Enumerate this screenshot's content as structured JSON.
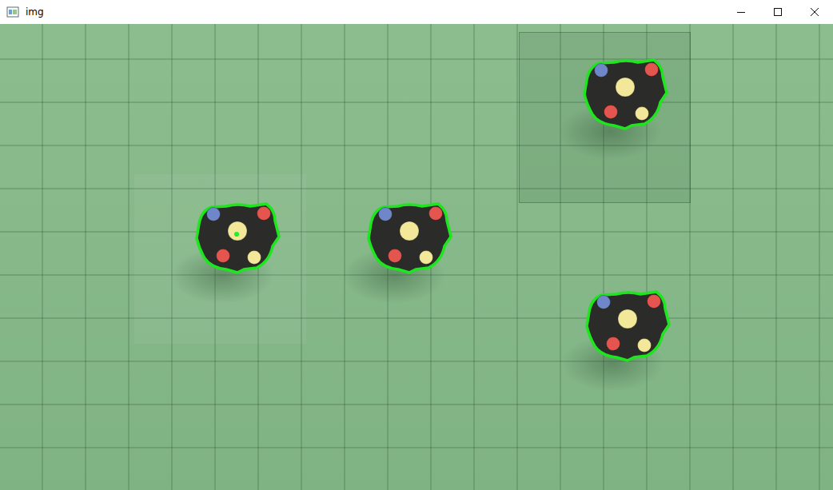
{
  "window": {
    "title": "img"
  },
  "roi": {
    "shown": true
  },
  "robots": [
    {
      "contour": true,
      "center_marker": true,
      "dots": [
        {
          "color": "#6f86c8",
          "big": false
        },
        {
          "color": "#e5554f",
          "big": false
        },
        {
          "color": "#f3e79a",
          "big": true
        },
        {
          "color": "#e5554f",
          "big": false
        },
        {
          "color": "#f3e79a",
          "big": false
        }
      ]
    },
    {
      "contour": true,
      "center_marker": false,
      "dots": [
        {
          "color": "#6f86c8",
          "big": false
        },
        {
          "color": "#e5554f",
          "big": false
        },
        {
          "color": "#f3e79a",
          "big": true
        },
        {
          "color": "#e5554f",
          "big": false
        },
        {
          "color": "#f3e79a",
          "big": false
        }
      ]
    },
    {
      "contour": true,
      "center_marker": false,
      "dots": [
        {
          "color": "#6f86c8",
          "big": false
        },
        {
          "color": "#e5554f",
          "big": false
        },
        {
          "color": "#f3e79a",
          "big": true
        },
        {
          "color": "#e5554f",
          "big": false
        },
        {
          "color": "#f3e79a",
          "big": false
        }
      ]
    },
    {
      "contour": true,
      "center_marker": false,
      "dots": [
        {
          "color": "#6f86c8",
          "big": false
        },
        {
          "color": "#e5554f",
          "big": false
        },
        {
          "color": "#f3e79a",
          "big": true
        },
        {
          "color": "#e5554f",
          "big": false
        },
        {
          "color": "#f3e79a",
          "big": false
        }
      ]
    }
  ]
}
